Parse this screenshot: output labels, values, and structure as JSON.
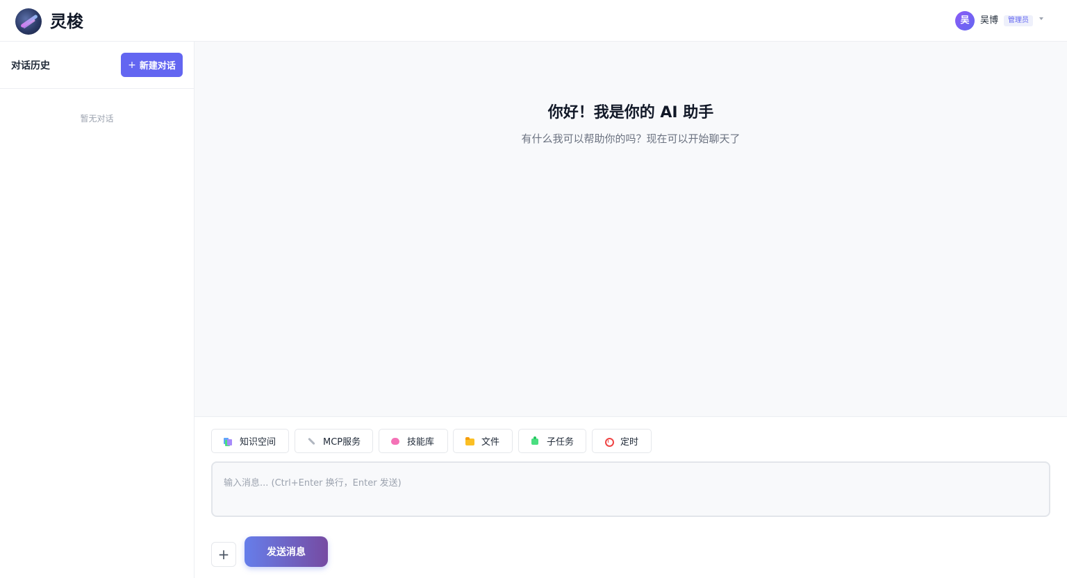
{
  "header": {
    "app_title": "灵梭",
    "user": {
      "avatar_initial": "吴",
      "name": "吴博",
      "role": "管理员"
    }
  },
  "sidebar": {
    "title": "对话历史",
    "new_chat_label": "新建对话",
    "new_chat_icon": "+",
    "empty_text": "暂无对话"
  },
  "main": {
    "welcome_title": "你好！我是你的 AI 助手",
    "welcome_subtitle": "有什么我可以帮助你的吗？现在可以开始聊天了"
  },
  "composer": {
    "tools": [
      {
        "label": "知识空间",
        "icon": "knowledge-icon"
      },
      {
        "label": "MCP服务",
        "icon": "wrench-icon"
      },
      {
        "label": "技能库",
        "icon": "brain-icon"
      },
      {
        "label": "文件",
        "icon": "folder-icon"
      },
      {
        "label": "子任务",
        "icon": "puzzle-icon"
      },
      {
        "label": "定时",
        "icon": "alarm-icon"
      }
    ],
    "input_value": "",
    "input_placeholder": "输入消息... (Ctrl+Enter 换行，Enter 发送)",
    "attach_label": "+",
    "send_label": "发送消息"
  },
  "colors": {
    "accent": "#6366f1",
    "send_gradient_start": "#667eea",
    "send_gradient_end": "#764ba2"
  }
}
